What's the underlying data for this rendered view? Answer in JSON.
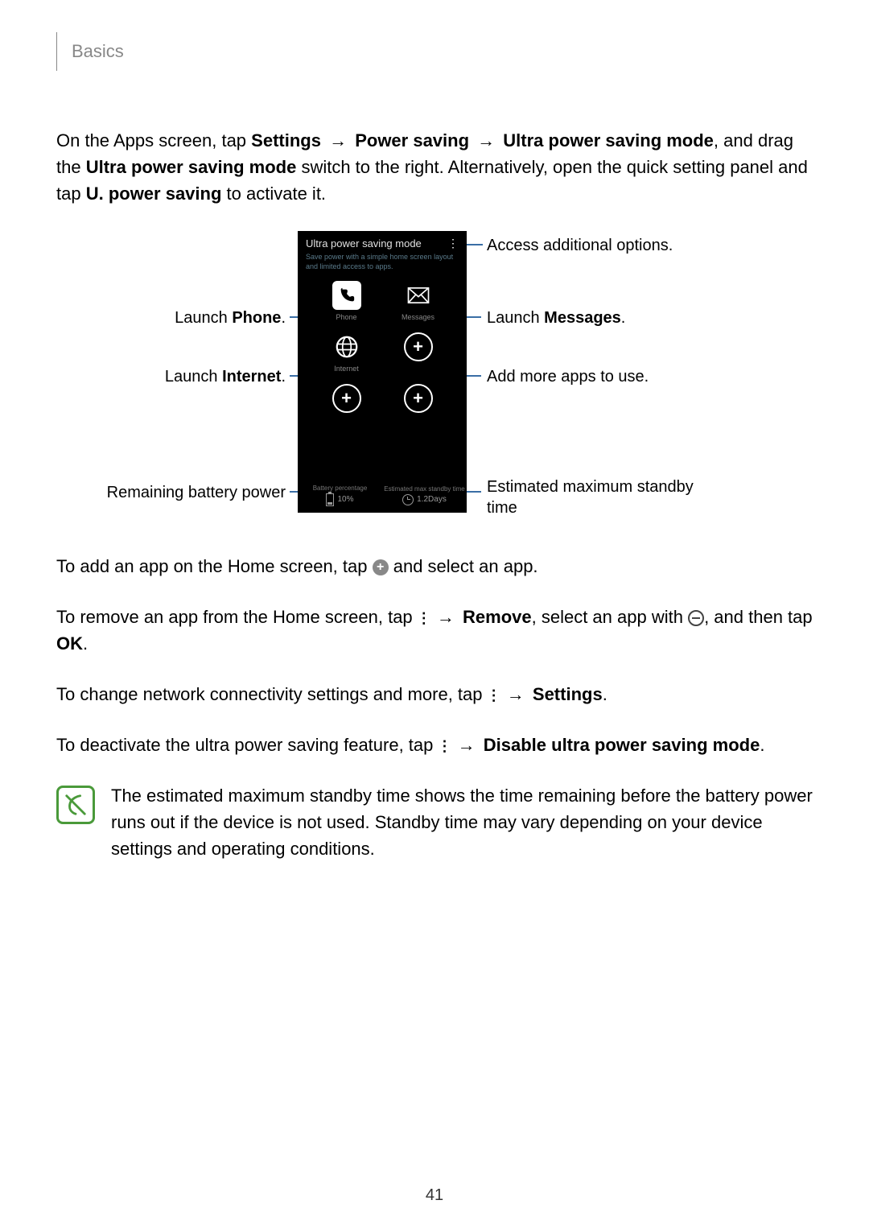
{
  "header": {
    "section": "Basics"
  },
  "intro": {
    "p1_a": "On the Apps screen, tap ",
    "p1_b": "Settings",
    "p1_c": "Power saving",
    "p1_d": "Ultra power saving mode",
    "p1_e": ", and drag the ",
    "p1_f": "Ultra power saving mode",
    "p1_g": " switch to the right. Alternatively, open the quick setting panel and tap ",
    "p1_h": "U. power saving",
    "p1_i": " to activate it."
  },
  "phone": {
    "title": "Ultra power saving mode",
    "subtitle": "Save power with a simple home screen layout and limited access to apps.",
    "apps": {
      "phone": "Phone",
      "messages": "Messages",
      "internet": "Internet"
    },
    "status": {
      "left_label": "Battery percentage",
      "left_value": "10%",
      "right_label": "Estimated max standby time",
      "right_value": "1.2Days"
    }
  },
  "callouts": {
    "options": "Access additional options.",
    "messages_a": "Launch ",
    "messages_b": "Messages",
    "add_more": "Add more apps to use.",
    "standby": "Estimated maximum standby time",
    "phone_a": "Launch ",
    "phone_b": "Phone",
    "internet_a": "Launch ",
    "internet_b": "Internet",
    "battery": "Remaining battery power"
  },
  "instr": {
    "add_a": "To add an app on the Home screen, tap ",
    "add_b": " and select an app.",
    "remove_a": "To remove an app from the Home screen, tap ",
    "remove_b": "Remove",
    "remove_c": ", select an app with ",
    "remove_d": ", and then tap ",
    "remove_e": "OK",
    "settings_a": "To change network connectivity settings and more, tap ",
    "settings_b": "Settings",
    "disable_a": "To deactivate the ultra power saving feature, tap ",
    "disable_b": "Disable ultra power saving mode"
  },
  "note": "The estimated maximum standby time shows the time remaining before the battery power runs out if the device is not used. Standby time may vary depending on your device settings and operating conditions.",
  "page_number": "41"
}
